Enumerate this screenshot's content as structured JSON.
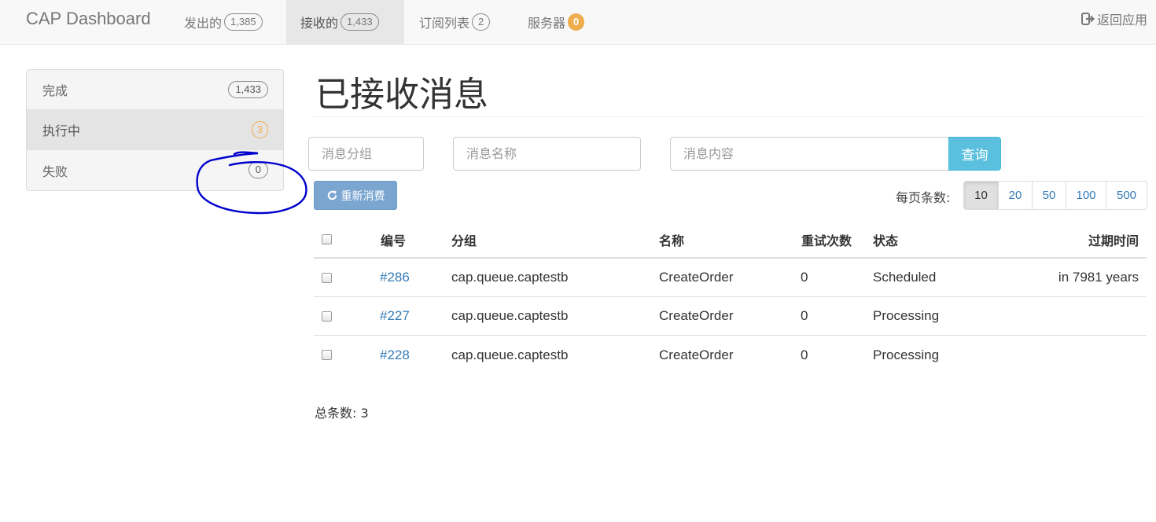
{
  "navbar": {
    "brand": "CAP Dashboard",
    "items": [
      {
        "label": "发出的",
        "badge": "1,385"
      },
      {
        "label": "接收的",
        "badge": "1,433"
      },
      {
        "label": "订阅列表",
        "badge": "2"
      },
      {
        "label": "服务器",
        "badge": "0"
      }
    ],
    "return_label": "返回应用"
  },
  "sidebar": {
    "items": [
      {
        "label": "完成",
        "badge": "1,433"
      },
      {
        "label": "执行中",
        "badge": "3"
      },
      {
        "label": "失败",
        "badge": "0"
      }
    ]
  },
  "main": {
    "title": "已接收消息",
    "filters": {
      "group_placeholder": "消息分组",
      "name_placeholder": "消息名称",
      "content_placeholder": "消息内容",
      "query_label": "查询"
    },
    "replay_label": "重新消费",
    "per_page_label": "每页条数:",
    "page_sizes": [
      "10",
      "20",
      "50",
      "100",
      "500"
    ],
    "table": {
      "headers": {
        "id": "编号",
        "group": "分组",
        "name": "名称",
        "retries": "重试次数",
        "status": "状态",
        "expires": "过期时间"
      },
      "rows": [
        {
          "id": "#286",
          "group": "cap.queue.captestb",
          "name": "CreateOrder",
          "retries": "0",
          "status": "Scheduled",
          "expires": "in 7981 years"
        },
        {
          "id": "#227",
          "group": "cap.queue.captestb",
          "name": "CreateOrder",
          "retries": "0",
          "status": "Processing",
          "expires": ""
        },
        {
          "id": "#228",
          "group": "cap.queue.captestb",
          "name": "CreateOrder",
          "retries": "0",
          "status": "Processing",
          "expires": ""
        }
      ]
    },
    "total_label": "总条数: 3"
  },
  "colors": {
    "navbar_bg": "#f8f8f8",
    "link": "#337ab7",
    "info_button": "#5bc0de",
    "warning_badge": "#f0ad4e",
    "annotation_ink": "#0000cc"
  },
  "icons": {
    "return": "sign-out-icon",
    "replay": "refresh-icon"
  }
}
